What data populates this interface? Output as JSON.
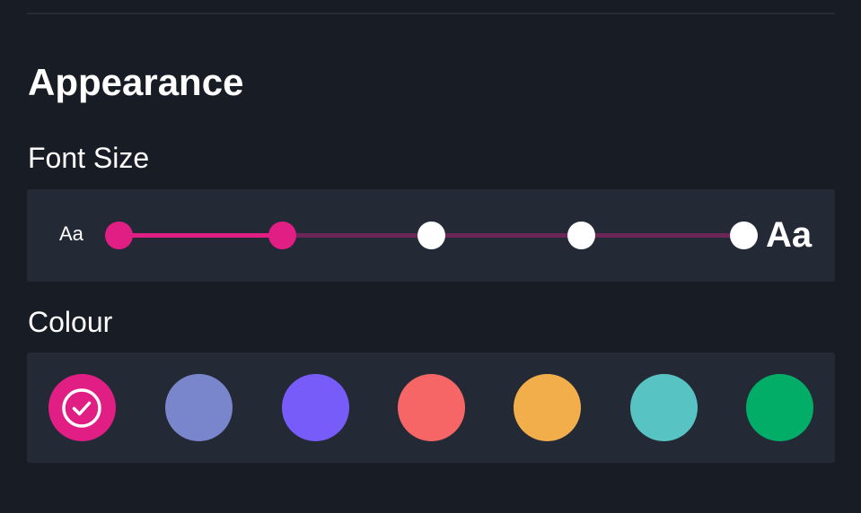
{
  "appearance": {
    "title": "Appearance"
  },
  "font_size": {
    "label": "Font Size",
    "small_preview": "Aa",
    "large_preview": "Aa",
    "steps": 5,
    "selected_index": 1,
    "accent_color": "#e01e84",
    "inactive_track_color": "#6b2557",
    "inactive_stop_color": "#ffffff"
  },
  "colour": {
    "label": "Colour",
    "selected_index": 0,
    "selected_icon": "check-circle-icon",
    "swatches": [
      {
        "name": "pink",
        "color": "#e01e84"
      },
      {
        "name": "periwinkle",
        "color": "#7986cb"
      },
      {
        "name": "violet",
        "color": "#785cfa"
      },
      {
        "name": "coral",
        "color": "#f76666"
      },
      {
        "name": "amber",
        "color": "#f2ae4b"
      },
      {
        "name": "teal",
        "color": "#58c3c3"
      },
      {
        "name": "green",
        "color": "#02ad67"
      }
    ]
  }
}
